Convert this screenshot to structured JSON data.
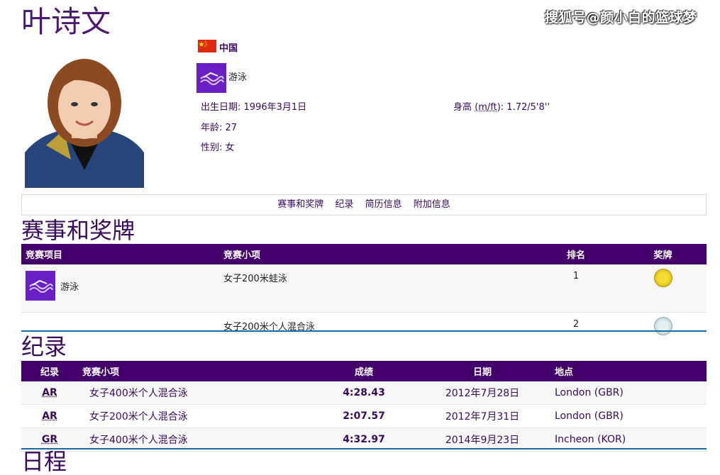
{
  "athlete": {
    "name": "叶诗文",
    "country": "中国",
    "sport": "游泳",
    "birth_label": "出生日期:",
    "birth_value": "1996年3月1日",
    "age_label": "年龄:",
    "age_value": "27",
    "gender_label": "性别:",
    "gender_value": "女",
    "height_label": "身高",
    "height_unit": "(m/ft)",
    "height_value": ": 1.72/5'8''"
  },
  "watermark": "搜狐号@颜小白的篮球梦",
  "nav": [
    "赛事和奖牌",
    "纪录",
    "简历信息",
    "附加信息"
  ],
  "events": {
    "title": "赛事和奖牌",
    "headers": [
      "竞赛项目",
      "竞赛小项",
      "排名",
      "奖牌"
    ],
    "rows": [
      {
        "sport": "游泳",
        "event": "女子200米蛙泳",
        "rank": "1",
        "medal": "gold"
      },
      {
        "sport": "",
        "event": "女子200米个人混合泳",
        "rank": "2",
        "medal": "silver"
      }
    ]
  },
  "records": {
    "title": "纪录",
    "headers": [
      "纪录",
      "竞赛小项",
      "成绩",
      "日期",
      "地点"
    ],
    "rows": [
      {
        "code": "AR",
        "event": "女子400米个人混合泳",
        "result": "4:28.43",
        "date": "2012年7月28日",
        "place": "London (GBR)"
      },
      {
        "code": "AR",
        "event": "女子200米个人混合泳",
        "result": "2:07.57",
        "date": "2012年7月31日",
        "place": "London (GBR)"
      },
      {
        "code": "GR",
        "event": "女子400米个人混合泳",
        "result": "4:32.97",
        "date": "2014年9月23日",
        "place": "Incheon (KOR)"
      }
    ]
  },
  "schedule": {
    "title": "日程"
  },
  "colors": {
    "accent": "#43006b",
    "divider": "#1a6aa3",
    "gold": "#d4b000",
    "silver": "#a9c6cc",
    "sport_tile": "#6a1fc4"
  }
}
